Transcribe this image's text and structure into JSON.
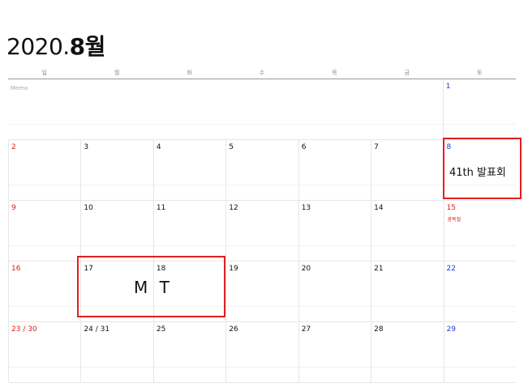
{
  "title": {
    "year": "2020.",
    "month": "8월"
  },
  "weekdays": [
    "일",
    "월",
    "화",
    "수",
    "목",
    "금",
    "토"
  ],
  "memo_label": "Memo",
  "weeks": [
    {
      "memo_row": true,
      "sat": "1"
    },
    {
      "days": [
        "2",
        "3",
        "4",
        "5",
        "6",
        "7",
        "8"
      ]
    },
    {
      "days": [
        "9",
        "10",
        "11",
        "12",
        "13",
        "14",
        "15"
      ],
      "holiday": "광복절"
    },
    {
      "days": [
        "16",
        "17",
        "18",
        "19",
        "20",
        "21",
        "22"
      ]
    },
    {
      "days": [
        "23 / 30",
        "24 / 31",
        "25",
        "26",
        "27",
        "28",
        "29"
      ]
    }
  ],
  "events": [
    {
      "label": "41th 발표회"
    },
    {
      "label": "M T"
    }
  ],
  "colors": {
    "sunday": "#d42020",
    "saturday": "#1a3bd6",
    "highlight": "#e41e1e"
  }
}
